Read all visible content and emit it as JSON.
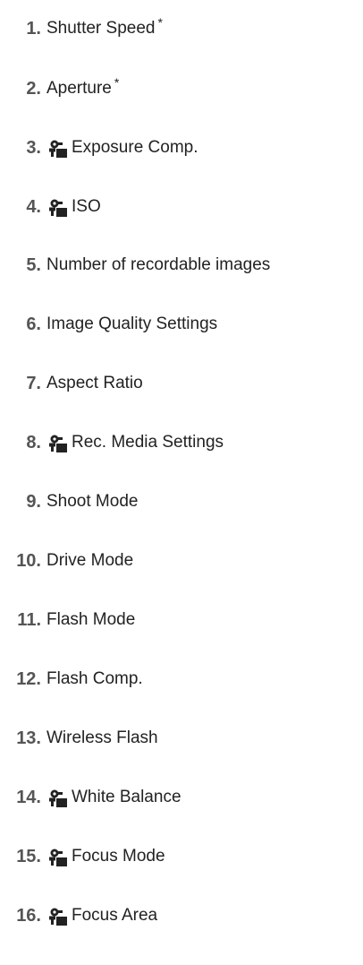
{
  "items": [
    {
      "num": "1.",
      "label": "Shutter Speed",
      "asterisk": "*",
      "icon": ""
    },
    {
      "num": "2.",
      "label": "Aperture",
      "asterisk": "*",
      "icon": ""
    },
    {
      "num": "3.",
      "label": "Exposure Comp.",
      "asterisk": "",
      "icon": "camera-function-icon"
    },
    {
      "num": "4.",
      "label": "ISO",
      "asterisk": "",
      "icon": "camera-function-icon"
    },
    {
      "num": "5.",
      "label": "Number of recordable images",
      "asterisk": "",
      "icon": ""
    },
    {
      "num": "6.",
      "label": "Image Quality Settings",
      "asterisk": "",
      "icon": ""
    },
    {
      "num": "7.",
      "label": "Aspect Ratio",
      "asterisk": "",
      "icon": ""
    },
    {
      "num": "8.",
      "label": "Rec. Media Settings",
      "asterisk": "",
      "icon": "camera-function-icon"
    },
    {
      "num": "9.",
      "label": "Shoot Mode",
      "asterisk": "",
      "icon": ""
    },
    {
      "num": "10.",
      "label": "Drive Mode",
      "asterisk": "",
      "icon": ""
    },
    {
      "num": "11.",
      "label": "Flash Mode",
      "asterisk": "",
      "icon": ""
    },
    {
      "num": "12.",
      "label": "Flash Comp.",
      "asterisk": "",
      "icon": ""
    },
    {
      "num": "13.",
      "label": "Wireless Flash",
      "asterisk": "",
      "icon": ""
    },
    {
      "num": "14.",
      "label": "White Balance",
      "asterisk": "",
      "icon": "camera-function-icon"
    },
    {
      "num": "15.",
      "label": "Focus Mode",
      "asterisk": "",
      "icon": "camera-function-icon"
    },
    {
      "num": "16.",
      "label": "Focus Area",
      "asterisk": "",
      "icon": "camera-function-icon"
    }
  ]
}
